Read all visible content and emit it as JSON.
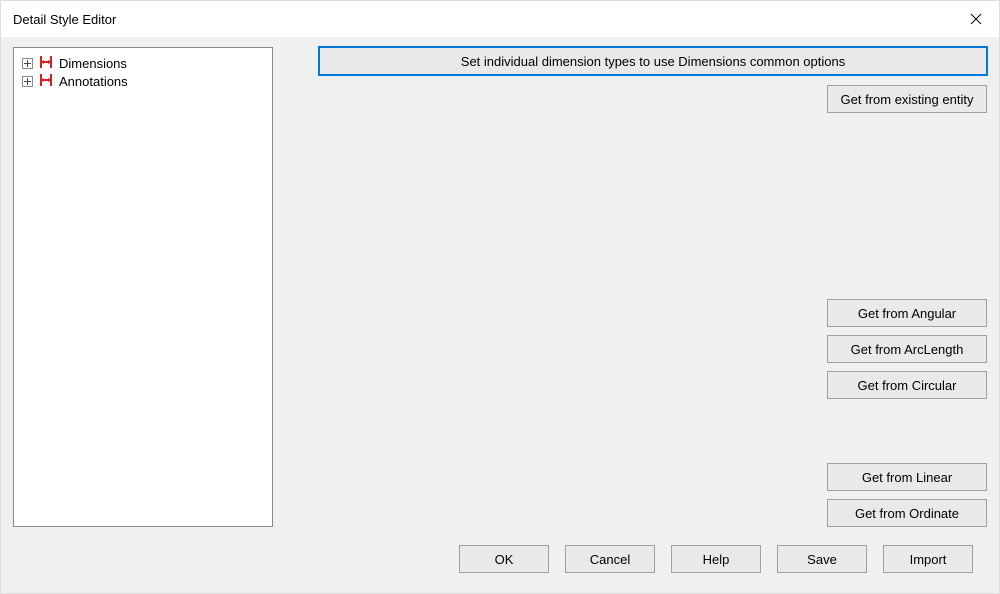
{
  "window": {
    "title": "Detail Style Editor"
  },
  "tree": {
    "items": [
      {
        "label": "Dimensions"
      },
      {
        "label": "Annotations"
      }
    ]
  },
  "main": {
    "set_common_options": "Set individual dimension types to use Dimensions common options",
    "get_from_existing": "Get from existing entity",
    "get_from_angular": "Get from Angular",
    "get_from_arclength": "Get from ArcLength",
    "get_from_circular": "Get from Circular",
    "get_from_linear": "Get from Linear",
    "get_from_ordinate": "Get from Ordinate"
  },
  "footer": {
    "ok": "OK",
    "cancel": "Cancel",
    "help": "Help",
    "save": "Save",
    "import": "Import"
  }
}
